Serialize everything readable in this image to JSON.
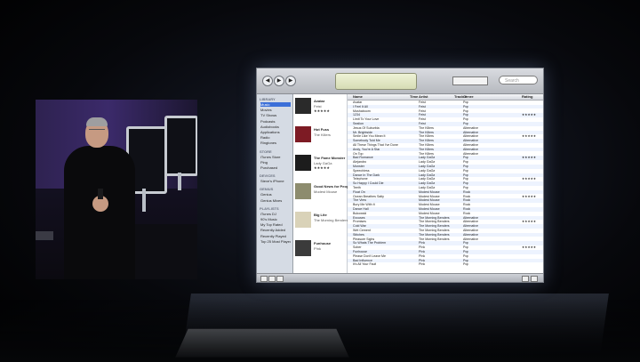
{
  "itunes": {
    "toolbar": {
      "title": "",
      "search_placeholder": "Search",
      "lcd_glyph": ""
    },
    "sidebar": {
      "groups": [
        {
          "header": "LIBRARY",
          "items": [
            "Music",
            "Movies",
            "TV Shows",
            "Podcasts",
            "Audiobooks",
            "Applications",
            "Radio",
            "Ringtones"
          ]
        },
        {
          "header": "STORE",
          "items": [
            "iTunes Store",
            "Ping",
            "Purchased"
          ]
        },
        {
          "header": "DEVICES",
          "items": [
            "Steve's iPhone"
          ]
        },
        {
          "header": "GENIUS",
          "items": [
            "Genius",
            "Genius Mixes"
          ]
        },
        {
          "header": "PLAYLISTS",
          "items": [
            "iTunes DJ",
            "90's Music",
            "My Top Rated",
            "Recently Added",
            "Recently Played",
            "Top 25 Most Played"
          ]
        }
      ],
      "selected": "Music"
    },
    "albums": [
      {
        "name": "Avatar",
        "artist": "Feist",
        "stars": "★★★★★",
        "color": "#2a2a2a"
      },
      {
        "name": "Hot Fuss",
        "artist": "The Killers",
        "stars": "",
        "color": "#7d1b24"
      },
      {
        "name": "The Fame Monster",
        "artist": "Lady GaGa",
        "stars": "★★★★★",
        "color": "#1c1c1c"
      },
      {
        "name": "Good News for People...",
        "artist": "Modest Mouse",
        "stars": "",
        "color": "#8d8c6e"
      },
      {
        "name": "Big Lite",
        "artist": "The Morning Benders",
        "stars": "",
        "color": "#d9d2b8"
      },
      {
        "name": "Funhouse",
        "artist": "P!nk",
        "stars": "",
        "color": "#3b3b3b"
      }
    ],
    "columns": [
      "Name",
      "Time",
      "Artist",
      "Track #",
      "Genre",
      "Rating"
    ],
    "rows": [
      [
        "Avatar",
        "",
        "Feist",
        "",
        "Pop",
        ""
      ],
      [
        "I Feel It All",
        "",
        "Feist",
        "",
        "Pop",
        ""
      ],
      [
        "Mushaboom",
        "",
        "Feist",
        "",
        "Pop",
        ""
      ],
      [
        "1234",
        "",
        "Feist",
        "",
        "Pop",
        "★★★★★"
      ],
      [
        "Limit To Your Love",
        "",
        "Feist",
        "",
        "Pop",
        ""
      ],
      [
        "Sealion",
        "",
        "Feist",
        "",
        "Pop",
        ""
      ],
      [
        "Jesus Of Suburbia",
        "",
        "The Killers",
        "",
        "Alternative",
        ""
      ],
      [
        "Mr. Brightside",
        "",
        "The Killers",
        "",
        "Alternative",
        ""
      ],
      [
        "Smile Like You Mean It",
        "",
        "The Killers",
        "",
        "Alternative",
        "★★★★★"
      ],
      [
        "Somebody Told Me",
        "",
        "The Killers",
        "",
        "Alternative",
        ""
      ],
      [
        "All These Things That I've Done",
        "",
        "The Killers",
        "",
        "Alternative",
        ""
      ],
      [
        "Andy, You're A Star",
        "",
        "The Killers",
        "",
        "Alternative",
        ""
      ],
      [
        "On Top",
        "",
        "The Killers",
        "",
        "Alternative",
        ""
      ],
      [
        "Bad Romance",
        "",
        "Lady GaGa",
        "",
        "Pop",
        "★★★★★"
      ],
      [
        "Alejandro",
        "",
        "Lady GaGa",
        "",
        "Pop",
        ""
      ],
      [
        "Monster",
        "",
        "Lady GaGa",
        "",
        "Pop",
        ""
      ],
      [
        "Speechless",
        "",
        "Lady GaGa",
        "",
        "Pop",
        ""
      ],
      [
        "Dance In The Dark",
        "",
        "Lady GaGa",
        "",
        "Pop",
        ""
      ],
      [
        "Telephone",
        "",
        "Lady GaGa",
        "",
        "Pop",
        "★★★★★"
      ],
      [
        "So Happy I Could Die",
        "",
        "Lady GaGa",
        "",
        "Pop",
        ""
      ],
      [
        "Teeth",
        "",
        "Lady GaGa",
        "",
        "Pop",
        ""
      ],
      [
        "Float On",
        "",
        "Modest Mouse",
        "",
        "Rock",
        ""
      ],
      [
        "Ocean Breathes Salty",
        "",
        "Modest Mouse",
        "",
        "Rock",
        "★★★★★"
      ],
      [
        "The View",
        "",
        "Modest Mouse",
        "",
        "Rock",
        ""
      ],
      [
        "Bury Me With It",
        "",
        "Modest Mouse",
        "",
        "Rock",
        ""
      ],
      [
        "Dance Hall",
        "",
        "Modest Mouse",
        "",
        "Rock",
        ""
      ],
      [
        "Bukowski",
        "",
        "Modest Mouse",
        "",
        "Rock",
        ""
      ],
      [
        "Excuses",
        "",
        "The Morning Benders",
        "",
        "Alternative",
        ""
      ],
      [
        "Promises",
        "",
        "The Morning Benders",
        "",
        "Alternative",
        "★★★★★"
      ],
      [
        "Cold War",
        "",
        "The Morning Benders",
        "",
        "Alternative",
        ""
      ],
      [
        "Wet Cement",
        "",
        "The Morning Benders",
        "",
        "Alternative",
        ""
      ],
      [
        "Stitches",
        "",
        "The Morning Benders",
        "",
        "Alternative",
        ""
      ],
      [
        "Pleasure Sighs",
        "",
        "The Morning Benders",
        "",
        "Alternative",
        ""
      ],
      [
        "So Whats The Problem",
        "",
        "P!nk",
        "",
        "Pop",
        ""
      ],
      [
        "Sober",
        "",
        "P!nk",
        "",
        "Pop",
        "★★★★★"
      ],
      [
        "Funhouse",
        "",
        "P!nk",
        "",
        "Pop",
        ""
      ],
      [
        "Please Don't Leave Me",
        "",
        "P!nk",
        "",
        "Pop",
        ""
      ],
      [
        "Bad Influence",
        "",
        "P!nk",
        "",
        "Pop",
        ""
      ],
      [
        "It's All Your Fault",
        "",
        "P!nk",
        "",
        "Pop",
        ""
      ]
    ],
    "status": ""
  }
}
